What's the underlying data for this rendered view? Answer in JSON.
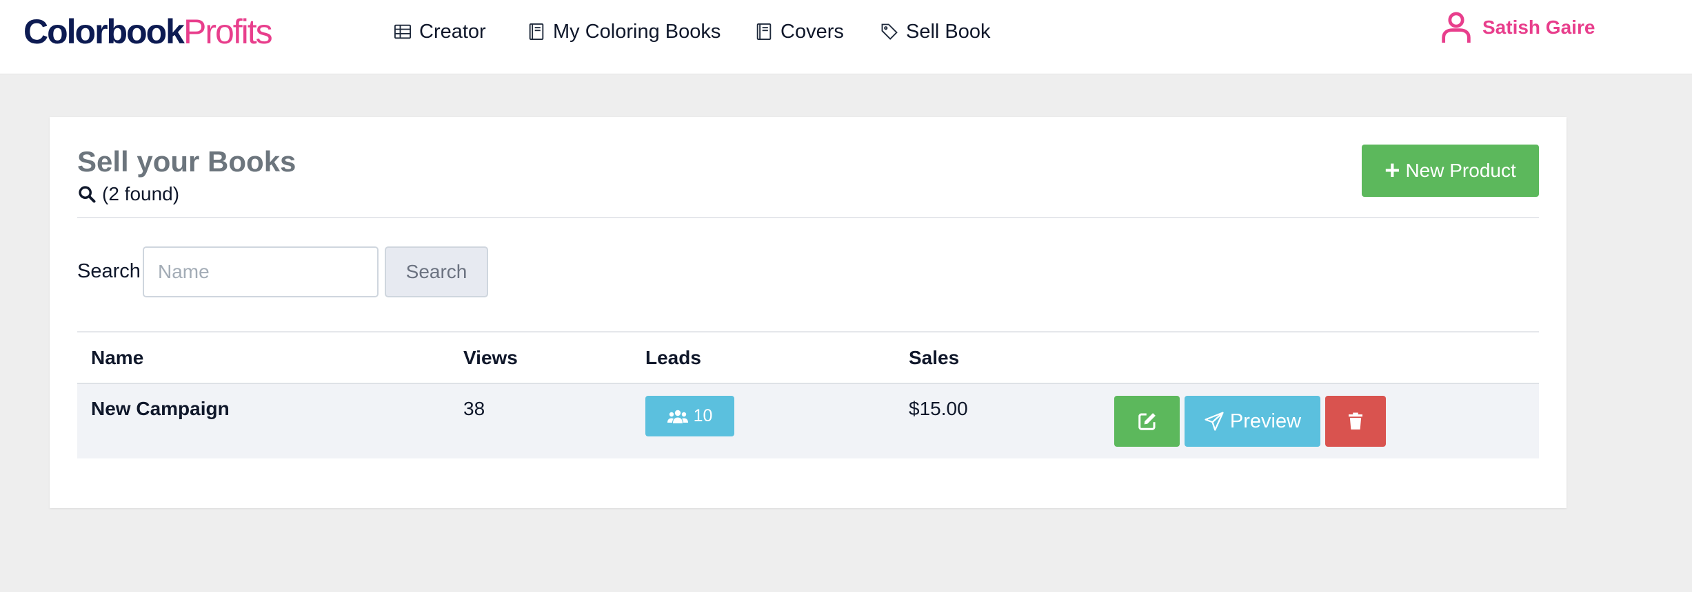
{
  "brand": {
    "part1": "Colorbook",
    "part2": "Profits"
  },
  "nav": {
    "creator": "Creator",
    "my_books": "My Coloring Books",
    "covers": "Covers",
    "sell_book": "Sell Book"
  },
  "user": {
    "name": "Satish Gaire",
    "icon": "user-icon"
  },
  "page": {
    "title": "Sell your Books",
    "found_text": "(2 found)",
    "new_product_label": "New Product"
  },
  "search": {
    "label": "Search",
    "placeholder": "Name",
    "value": "",
    "button_label": "Search"
  },
  "table": {
    "columns": [
      "Name",
      "Views",
      "Leads",
      "Sales"
    ],
    "rows": [
      {
        "name": "New Campaign",
        "views": "38",
        "leads": "10",
        "sales": "$15.00",
        "preview_label": "Preview"
      }
    ]
  },
  "colors": {
    "brand_dark": "#0d1b52",
    "brand_pink": "#e83e8c",
    "success": "#5cb85c",
    "info": "#5bc0de",
    "danger": "#d9534f",
    "title_gray": "#6c757d"
  }
}
